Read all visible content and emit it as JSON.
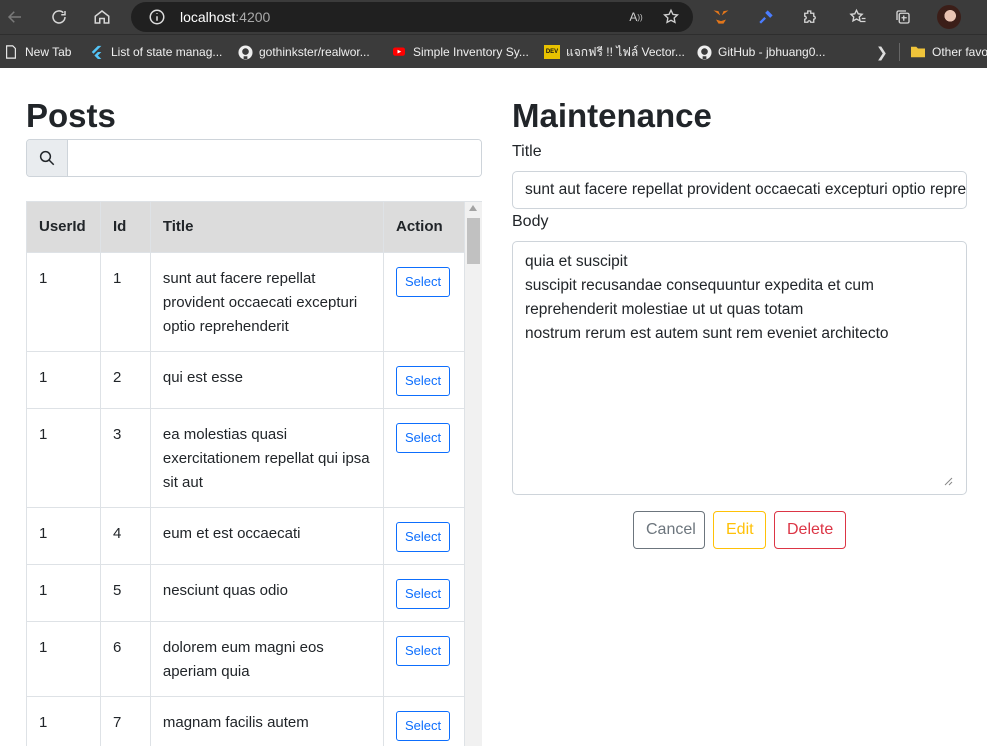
{
  "browser": {
    "url_host": "localhost",
    "url_port": ":4200",
    "bookmarks": [
      {
        "label": "New Tab",
        "icon": "new-tab-icon"
      },
      {
        "label": "List of state manag...",
        "icon": "flutter-icon"
      },
      {
        "label": "gothinkster/realwor...",
        "icon": "github-icon"
      },
      {
        "label": "Simple Inventory Sy...",
        "icon": "youtube-icon"
      },
      {
        "label": "แจกฟรี !! ไฟล์ Vector...",
        "icon": "dev-icon"
      },
      {
        "label": "GitHub - jbhuang0...",
        "icon": "github-icon"
      },
      {
        "label": "Other favo",
        "icon": "folder-icon"
      }
    ],
    "dev_badge": "DEV",
    "read_aloud_label": "A"
  },
  "posts": {
    "title": "Posts",
    "search": {
      "placeholder": "",
      "value": ""
    },
    "columns": [
      "UserId",
      "Id",
      "Title",
      "Action"
    ],
    "rows": [
      {
        "userId": "1",
        "id": "1",
        "title": "sunt aut facere repellat provident occaecati excepturi optio reprehenderit",
        "action": "Select"
      },
      {
        "userId": "1",
        "id": "2",
        "title": "qui est esse",
        "action": "Select"
      },
      {
        "userId": "1",
        "id": "3",
        "title": "ea molestias quasi exercitationem repellat qui ipsa sit aut",
        "action": "Select"
      },
      {
        "userId": "1",
        "id": "4",
        "title": "eum et est occaecati",
        "action": "Select"
      },
      {
        "userId": "1",
        "id": "5",
        "title": "nesciunt quas odio",
        "action": "Select"
      },
      {
        "userId": "1",
        "id": "6",
        "title": "dolorem eum magni eos aperiam quia",
        "action": "Select"
      },
      {
        "userId": "1",
        "id": "7",
        "title": "magnam facilis autem",
        "action": "Select"
      }
    ]
  },
  "maintenance": {
    "title": "Maintenance",
    "title_label": "Title",
    "title_value": "sunt aut facere repellat provident occaecati excepturi optio reprehenderit",
    "body_label": "Body",
    "body_value": "quia et suscipit\nsuscipit recusandae consequuntur expedita et cum\nreprehenderit molestiae ut ut quas totam\nnostrum rerum est autem sunt rem eveniet architecto",
    "buttons": {
      "cancel": "Cancel",
      "edit": "Edit",
      "delete": "Delete"
    }
  },
  "colors": {
    "primary": "#0d6efd",
    "secondary": "#6c757d",
    "warning": "#ffc107",
    "danger": "#dc3545",
    "chrome": "#3b3b3b",
    "header_bg": "#dcdcdc"
  }
}
